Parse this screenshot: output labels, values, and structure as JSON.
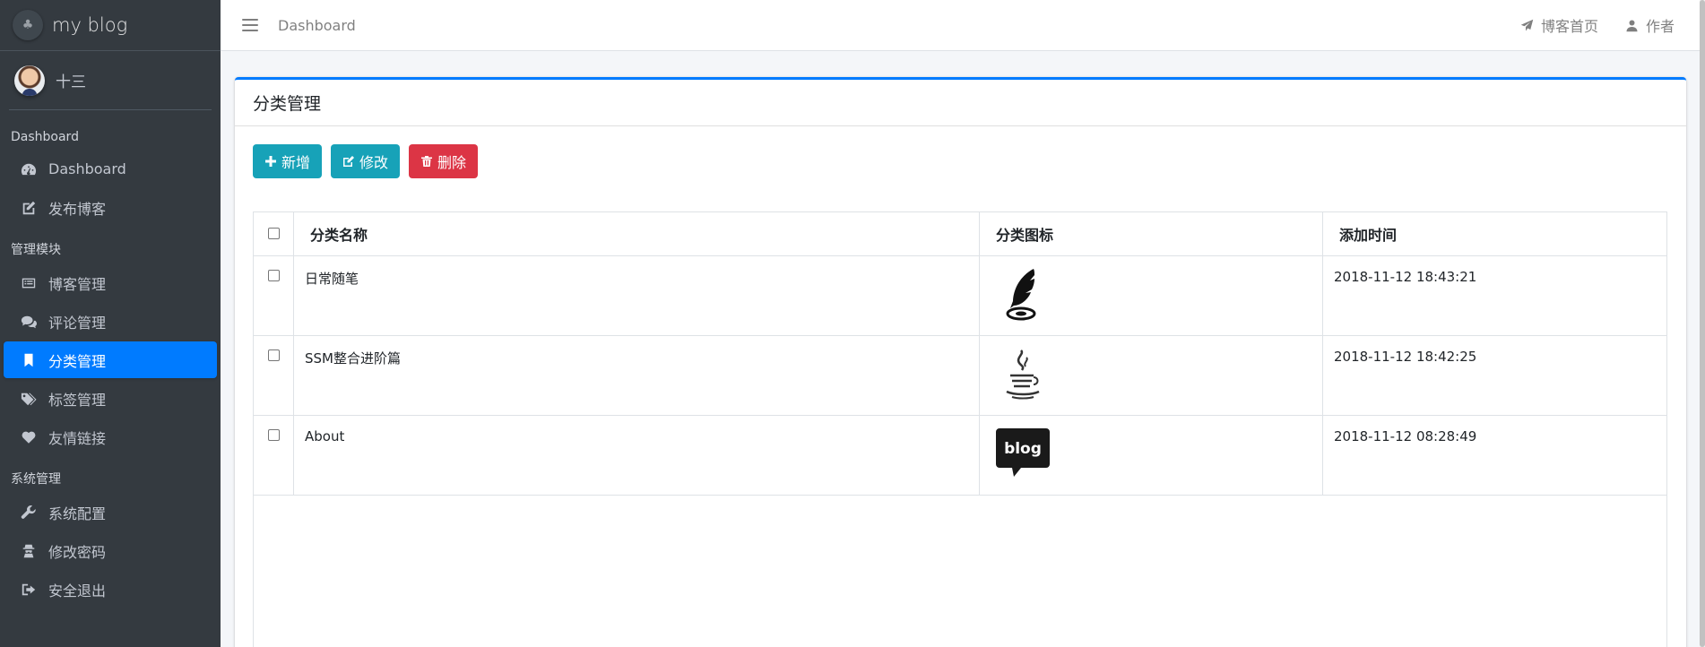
{
  "brand": {
    "title": "my blog"
  },
  "user": {
    "name": "十三"
  },
  "nav": {
    "header_dashboard": "Dashboard",
    "dashboard": "Dashboard",
    "publish": "发布博客",
    "header_manage": "管理模块",
    "blog_manage": "博客管理",
    "comment_manage": "评论管理",
    "category_manage": "分类管理",
    "tag_manage": "标签管理",
    "link_manage": "友情链接",
    "header_system": "系统管理",
    "system_config": "系统配置",
    "change_password": "修改密码",
    "logout": "安全退出"
  },
  "topbar": {
    "breadcrumb": "Dashboard",
    "home_link": "博客首页",
    "author_link": "作者"
  },
  "card": {
    "title": "分类管理",
    "add_label": "新增",
    "edit_label": "修改",
    "delete_label": "删除"
  },
  "table": {
    "headers": [
      "分类名称",
      "分类图标",
      "添加时间"
    ],
    "rows": [
      {
        "name": "日常随笔",
        "icon": "feather-pen-icon",
        "time": "2018-11-12 18:43:21"
      },
      {
        "name": "SSM整合进阶篇",
        "icon": "java-coffee-icon",
        "time": "2018-11-12 18:42:25"
      },
      {
        "name": "About",
        "icon": "blog-bubble-icon",
        "time": "2018-11-12 08:28:49"
      }
    ]
  },
  "colors": {
    "sidebar_bg": "#343a40",
    "active": "#007bff",
    "info": "#17a2b8",
    "danger": "#dc3545"
  }
}
